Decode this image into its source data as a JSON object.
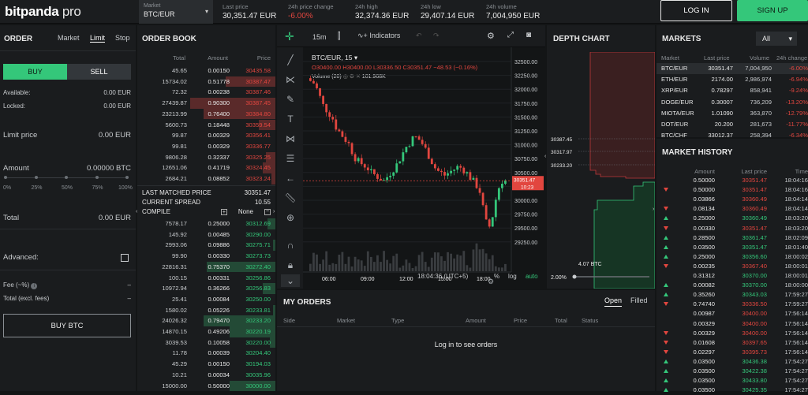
{
  "header": {
    "logo_bold": "bitpanda",
    "logo_light": " pro",
    "market_label": "Market",
    "market_value": "BTC/EUR",
    "stats": [
      {
        "label": "Last price",
        "value": "30,351.47 EUR",
        "neg": false
      },
      {
        "label": "24h price change",
        "value": "-6.00%",
        "neg": true
      },
      {
        "label": "24h high",
        "value": "32,374.36 EUR",
        "neg": false
      },
      {
        "label": "24h low",
        "value": "29,407.14 EUR",
        "neg": false
      },
      {
        "label": "24h volume",
        "value": "7,004,950 EUR",
        "neg": false
      }
    ],
    "login": "LOG IN",
    "signup": "SIGN UP"
  },
  "order": {
    "title": "ORDER",
    "tabs": [
      "Market",
      "Limit",
      "Stop"
    ],
    "buy": "BUY",
    "sell": "SELL",
    "available_label": "Available:",
    "available_value": "0.00 EUR",
    "locked_label": "Locked:",
    "locked_value": "0.00 EUR",
    "limit_label": "Limit price",
    "limit_value": "0.00 EUR",
    "amount_label": "Amount",
    "amount_value": "0.00000 BTC",
    "pcts": [
      "0%",
      "25%",
      "50%",
      "75%",
      "100%"
    ],
    "total_label": "Total",
    "total_value": "0.00 EUR",
    "advanced_label": "Advanced:",
    "fee_label": "Fee (~%)",
    "fee_value": "–",
    "total_excl_label": "Total (excl. fees)",
    "total_excl_value": "–",
    "buy_btc": "BUY BTC"
  },
  "book": {
    "title": "ORDER BOOK",
    "headers": [
      "Total",
      "Amount",
      "Price"
    ],
    "asks": [
      [
        "45.65",
        "0.00150",
        "30435.58",
        0
      ],
      [
        "15734.02",
        "0.51778",
        "30387.47",
        0.36
      ],
      [
        "72.32",
        "0.00238",
        "30387.46",
        0
      ],
      [
        "27439.87",
        "0.90300",
        "30387.45",
        0.62
      ],
      [
        "23213.99",
        "0.76400",
        "30384.80",
        0.52
      ],
      [
        "5600.73",
        "0.18448",
        "30359.54",
        0.12
      ],
      [
        "99.87",
        "0.00329",
        "30356.41",
        0
      ],
      [
        "99.81",
        "0.00329",
        "30336.77",
        0
      ],
      [
        "9806.28",
        "0.32337",
        "30325.25",
        0.07
      ],
      [
        "12651.06",
        "0.41719",
        "30324.45",
        0.09
      ],
      [
        "2684.21",
        "0.08852",
        "30323.24",
        0.03
      ]
    ],
    "last_matched_label": "LAST MATCHED PRICE",
    "last_matched_value": "30351.47",
    "spread_label": "CURRENT SPREAD",
    "spread_value": "10.55",
    "compile_label": "COMPILE",
    "compile_value": "None",
    "bids": [
      [
        "7578.17",
        "0.25000",
        "30312.69",
        0.06
      ],
      [
        "145.92",
        "0.00485",
        "30290.00",
        0
      ],
      [
        "2993.06",
        "0.09886",
        "30275.71",
        0.02
      ],
      [
        "99.90",
        "0.00330",
        "30273.73",
        0
      ],
      [
        "22816.31",
        "0.75370",
        "30272.40",
        0.5
      ],
      [
        "100.15",
        "0.00331",
        "30256.86",
        0
      ],
      [
        "10972.94",
        "0.36266",
        "30256.83",
        0.09
      ],
      [
        "25.41",
        "0.00084",
        "30250.00",
        0
      ],
      [
        "1580.02",
        "0.05226",
        "30233.81",
        0.02
      ],
      [
        "24026.32",
        "0.79470",
        "30233.20",
        0.52
      ],
      [
        "14870.15",
        "0.49206",
        "30220.19",
        0.33
      ],
      [
        "3039.53",
        "0.10058",
        "30220.00",
        0.04
      ],
      [
        "11.78",
        "0.00039",
        "30204.40",
        0
      ],
      [
        "45.29",
        "0.00150",
        "30194.03",
        0
      ],
      [
        "10.21",
        "0.00034",
        "30035.96",
        0
      ],
      [
        "15000.00",
        "0.50000",
        "30000.00",
        0.33
      ]
    ]
  },
  "chart": {
    "interval": "15m",
    "indicators": "Indicators",
    "symbol": "BTC/EUR, 15",
    "ohlc": "O30400.00 H30400.00 L30336.50 C30351.47 −48.53 (−0.16%)",
    "volume_label": "Volume (20)",
    "volume_value": "101.968K",
    "yticks": [
      "32500.00",
      "32250.00",
      "32000.00",
      "31750.00",
      "31500.00",
      "31250.00",
      "31000.00",
      "30750.00",
      "30500.00",
      "30250.00",
      "30000.00",
      "29750.00",
      "29500.00",
      "29250.00"
    ],
    "price_tag": "30351.47",
    "price_tag2": "10:23",
    "xticks": [
      "06:00",
      "09:00",
      "12:00",
      "15:00",
      "18:00"
    ],
    "time_readout": "18:04:36 (UTC+5)",
    "pct_toggle": "%",
    "log_toggle": "log",
    "auto_toggle": "auto"
  },
  "depth": {
    "title": "DEPTH CHART",
    "labels": [
      "30387.45",
      "30317.97",
      "30233.20"
    ],
    "volume": "4.07 BTC",
    "zoom": "2.00%"
  },
  "myorders": {
    "title": "MY ORDERS",
    "open_tab": "Open",
    "filled_tab": "Filled",
    "headers": [
      "Side",
      "Market",
      "Type",
      "Amount",
      "Price",
      "Total",
      "Status"
    ],
    "empty": "Log in to see orders"
  },
  "markets": {
    "title": "MARKETS",
    "filter": "All",
    "headers": [
      "Market",
      "Last price",
      "Volume",
      "24h change"
    ],
    "rows": [
      [
        "BTC/EUR",
        "30351.47",
        "7,004,950",
        "-6.00%"
      ],
      [
        "ETH/EUR",
        "2174.00",
        "2,986,974",
        "-6.94%"
      ],
      [
        "XRP/EUR",
        "0.78297",
        "858,941",
        "-9.24%"
      ],
      [
        "DOGE/EUR",
        "0.30007",
        "736,209",
        "-13.20%"
      ],
      [
        "MIOTA/EUR",
        "1.01090",
        "363,870",
        "-12.79%"
      ],
      [
        "DOT/EUR",
        "20.200",
        "281,673",
        "-11.77%"
      ],
      [
        "BTC/CHF",
        "33012.37",
        "258,394",
        "-6.34%"
      ]
    ]
  },
  "history": {
    "title": "MARKET HISTORY",
    "headers": [
      "Amount",
      "Last price",
      "Time"
    ],
    "rows": [
      [
        "",
        "0.50000",
        "30351.47",
        "18:04:16",
        "neg"
      ],
      [
        "dn",
        "0.50000",
        "30351.47",
        "18:04:16",
        "neg"
      ],
      [
        "",
        "0.03866",
        "30360.49",
        "18:04:14",
        "neg"
      ],
      [
        "dn",
        "0.08134",
        "30360.49",
        "18:04:14",
        "neg"
      ],
      [
        "up",
        "0.25000",
        "30360.49",
        "18:03:20",
        "pos"
      ],
      [
        "dn",
        "0.00330",
        "30351.47",
        "18:03:20",
        "neg"
      ],
      [
        "up",
        "0.28500",
        "30361.47",
        "18:02:09",
        "pos"
      ],
      [
        "up",
        "0.03500",
        "30351.47",
        "18:01:40",
        "pos"
      ],
      [
        "up",
        "0.25000",
        "30356.60",
        "18:00:02",
        "pos"
      ],
      [
        "dn",
        "0.00235",
        "30367.40",
        "18:00:01",
        "neg"
      ],
      [
        "",
        "0.31312",
        "30370.00",
        "18:00:01",
        "pos"
      ],
      [
        "up",
        "0.00082",
        "30370.00",
        "18:00:00",
        "pos"
      ],
      [
        "up",
        "0.35260",
        "30343.03",
        "17:59:27",
        "pos"
      ],
      [
        "dn",
        "0.74740",
        "30336.50",
        "17:59:27",
        "neg"
      ],
      [
        "",
        "0.00987",
        "30400.00",
        "17:56:14",
        "neg"
      ],
      [
        "",
        "0.00329",
        "30400.00",
        "17:56:14",
        "neg"
      ],
      [
        "dn",
        "0.00329",
        "30400.00",
        "17:56:14",
        "neg"
      ],
      [
        "dn",
        "0.01608",
        "30397.65",
        "17:56:14",
        "neg"
      ],
      [
        "dn",
        "0.02297",
        "30395.73",
        "17:56:14",
        "neg"
      ],
      [
        "up",
        "0.03500",
        "30436.38",
        "17:54:27",
        "pos"
      ],
      [
        "up",
        "0.03500",
        "30422.38",
        "17:54:27",
        "pos"
      ],
      [
        "up",
        "0.03500",
        "30433.80",
        "17:54:27",
        "pos"
      ],
      [
        "up",
        "0.03500",
        "30425.35",
        "17:54:27",
        "pos"
      ]
    ]
  }
}
